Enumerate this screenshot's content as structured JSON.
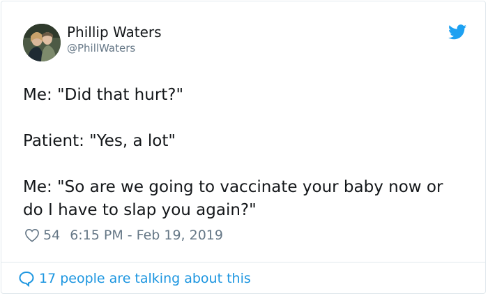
{
  "author": {
    "name": "Phillip Waters",
    "handle": "@PhillWaters"
  },
  "tweet": {
    "text": "Me: \"Did that hurt?\"\n\nPatient: \"Yes, a lot\"\n\nMe: \"So are we going to vaccinate your baby now or\ndo I have to slap you again?\""
  },
  "stats": {
    "likes": "54",
    "timestamp": "6:15 PM - Feb 19, 2019"
  },
  "footer": {
    "conversation_label": "17 people are talking about this"
  },
  "colors": {
    "brand": "#1da1f2",
    "link": "#1b95e0",
    "muted": "#657786",
    "text": "#14171a"
  },
  "icons": {
    "platform": "twitter-bird-icon",
    "like": "heart-icon",
    "reply": "speech-bubble-icon"
  }
}
